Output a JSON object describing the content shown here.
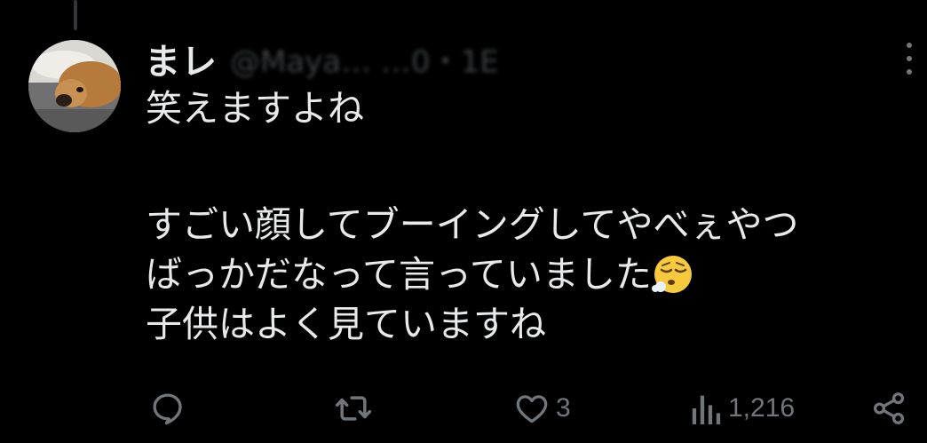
{
  "tweet": {
    "author": {
      "display_name": "まレ",
      "handle_meta_blurred": "@Maya…  …0・1E"
    },
    "text_lines": [
      "笑えますよね",
      "",
      "すごい顔してブーイングしてやべぇやつ",
      "ばっかだなって言っていました",
      "子供はよく見ていますね"
    ],
    "emoji": "face-exhaling-emoji"
  },
  "actions": {
    "reply": {
      "icon": "reply-icon"
    },
    "retweet": {
      "icon": "retweet-icon"
    },
    "like": {
      "icon": "heart-icon",
      "count": "3"
    },
    "views": {
      "icon": "views-icon",
      "count": "1,216"
    },
    "share": {
      "icon": "share-icon"
    }
  },
  "colors": {
    "background": "#000000",
    "text": "#e7e9ea",
    "muted": "#71767b"
  }
}
